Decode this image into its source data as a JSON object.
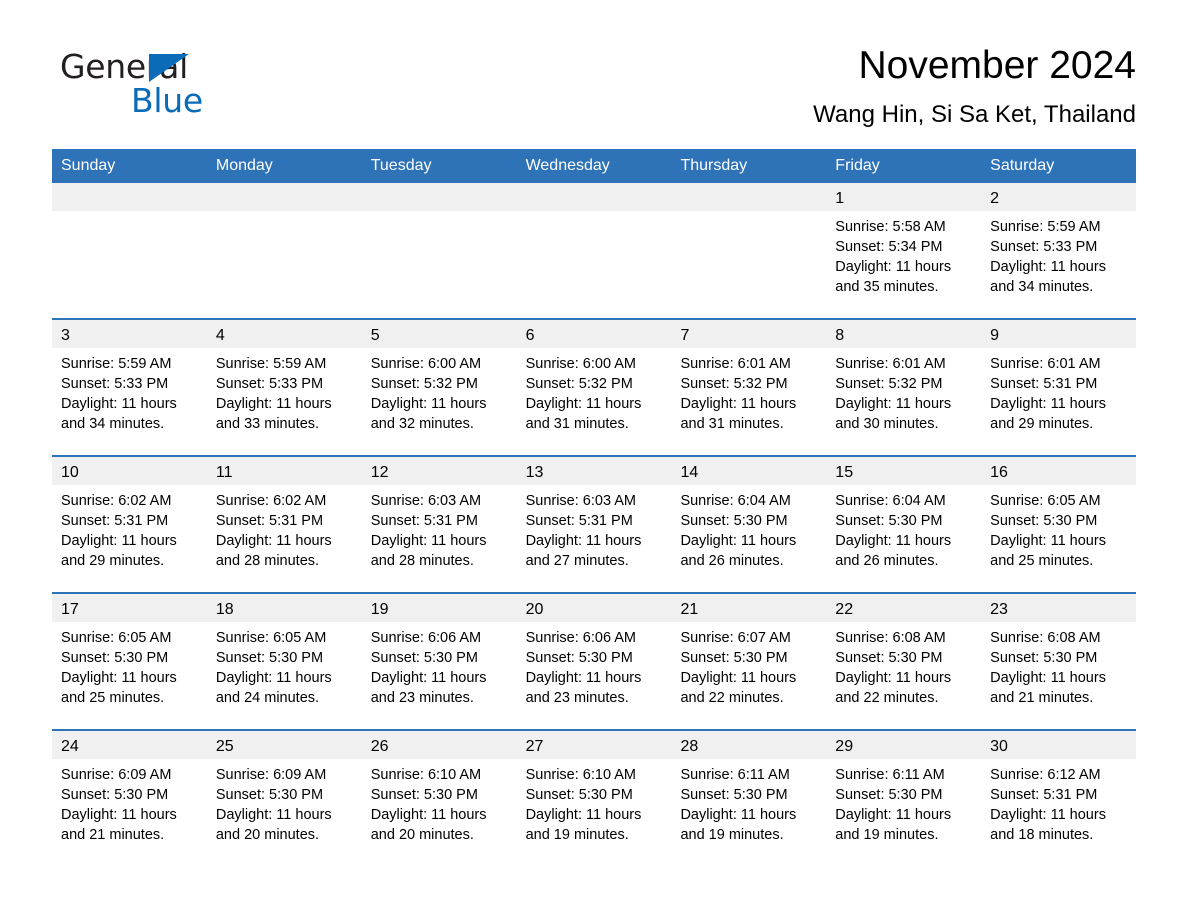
{
  "logo": {
    "word_dark": "General",
    "word_blue": "Blue",
    "triangle_color": "#0a6cb8"
  },
  "header": {
    "title": "November 2024",
    "subtitle": "Wang Hin, Si Sa Ket, Thailand"
  },
  "colors": {
    "header_blue": "#2e72b8",
    "date_strip": "#f0f0f0",
    "text": "#000000",
    "logo_blue": "#0a6cb8"
  },
  "weekdays": [
    "Sunday",
    "Monday",
    "Tuesday",
    "Wednesday",
    "Thursday",
    "Friday",
    "Saturday"
  ],
  "weeks": [
    [
      {
        "day": "",
        "sunrise": "",
        "sunset": "",
        "daylight": ""
      },
      {
        "day": "",
        "sunrise": "",
        "sunset": "",
        "daylight": ""
      },
      {
        "day": "",
        "sunrise": "",
        "sunset": "",
        "daylight": ""
      },
      {
        "day": "",
        "sunrise": "",
        "sunset": "",
        "daylight": ""
      },
      {
        "day": "",
        "sunrise": "",
        "sunset": "",
        "daylight": ""
      },
      {
        "day": "1",
        "sunrise": "Sunrise: 5:58 AM",
        "sunset": "Sunset: 5:34 PM",
        "daylight": "Daylight: 11 hours and 35 minutes."
      },
      {
        "day": "2",
        "sunrise": "Sunrise: 5:59 AM",
        "sunset": "Sunset: 5:33 PM",
        "daylight": "Daylight: 11 hours and 34 minutes."
      }
    ],
    [
      {
        "day": "3",
        "sunrise": "Sunrise: 5:59 AM",
        "sunset": "Sunset: 5:33 PM",
        "daylight": "Daylight: 11 hours and 34 minutes."
      },
      {
        "day": "4",
        "sunrise": "Sunrise: 5:59 AM",
        "sunset": "Sunset: 5:33 PM",
        "daylight": "Daylight: 11 hours and 33 minutes."
      },
      {
        "day": "5",
        "sunrise": "Sunrise: 6:00 AM",
        "sunset": "Sunset: 5:32 PM",
        "daylight": "Daylight: 11 hours and 32 minutes."
      },
      {
        "day": "6",
        "sunrise": "Sunrise: 6:00 AM",
        "sunset": "Sunset: 5:32 PM",
        "daylight": "Daylight: 11 hours and 31 minutes."
      },
      {
        "day": "7",
        "sunrise": "Sunrise: 6:01 AM",
        "sunset": "Sunset: 5:32 PM",
        "daylight": "Daylight: 11 hours and 31 minutes."
      },
      {
        "day": "8",
        "sunrise": "Sunrise: 6:01 AM",
        "sunset": "Sunset: 5:32 PM",
        "daylight": "Daylight: 11 hours and 30 minutes."
      },
      {
        "day": "9",
        "sunrise": "Sunrise: 6:01 AM",
        "sunset": "Sunset: 5:31 PM",
        "daylight": "Daylight: 11 hours and 29 minutes."
      }
    ],
    [
      {
        "day": "10",
        "sunrise": "Sunrise: 6:02 AM",
        "sunset": "Sunset: 5:31 PM",
        "daylight": "Daylight: 11 hours and 29 minutes."
      },
      {
        "day": "11",
        "sunrise": "Sunrise: 6:02 AM",
        "sunset": "Sunset: 5:31 PM",
        "daylight": "Daylight: 11 hours and 28 minutes."
      },
      {
        "day": "12",
        "sunrise": "Sunrise: 6:03 AM",
        "sunset": "Sunset: 5:31 PM",
        "daylight": "Daylight: 11 hours and 28 minutes."
      },
      {
        "day": "13",
        "sunrise": "Sunrise: 6:03 AM",
        "sunset": "Sunset: 5:31 PM",
        "daylight": "Daylight: 11 hours and 27 minutes."
      },
      {
        "day": "14",
        "sunrise": "Sunrise: 6:04 AM",
        "sunset": "Sunset: 5:30 PM",
        "daylight": "Daylight: 11 hours and 26 minutes."
      },
      {
        "day": "15",
        "sunrise": "Sunrise: 6:04 AM",
        "sunset": "Sunset: 5:30 PM",
        "daylight": "Daylight: 11 hours and 26 minutes."
      },
      {
        "day": "16",
        "sunrise": "Sunrise: 6:05 AM",
        "sunset": "Sunset: 5:30 PM",
        "daylight": "Daylight: 11 hours and 25 minutes."
      }
    ],
    [
      {
        "day": "17",
        "sunrise": "Sunrise: 6:05 AM",
        "sunset": "Sunset: 5:30 PM",
        "daylight": "Daylight: 11 hours and 25 minutes."
      },
      {
        "day": "18",
        "sunrise": "Sunrise: 6:05 AM",
        "sunset": "Sunset: 5:30 PM",
        "daylight": "Daylight: 11 hours and 24 minutes."
      },
      {
        "day": "19",
        "sunrise": "Sunrise: 6:06 AM",
        "sunset": "Sunset: 5:30 PM",
        "daylight": "Daylight: 11 hours and 23 minutes."
      },
      {
        "day": "20",
        "sunrise": "Sunrise: 6:06 AM",
        "sunset": "Sunset: 5:30 PM",
        "daylight": "Daylight: 11 hours and 23 minutes."
      },
      {
        "day": "21",
        "sunrise": "Sunrise: 6:07 AM",
        "sunset": "Sunset: 5:30 PM",
        "daylight": "Daylight: 11 hours and 22 minutes."
      },
      {
        "day": "22",
        "sunrise": "Sunrise: 6:08 AM",
        "sunset": "Sunset: 5:30 PM",
        "daylight": "Daylight: 11 hours and 22 minutes."
      },
      {
        "day": "23",
        "sunrise": "Sunrise: 6:08 AM",
        "sunset": "Sunset: 5:30 PM",
        "daylight": "Daylight: 11 hours and 21 minutes."
      }
    ],
    [
      {
        "day": "24",
        "sunrise": "Sunrise: 6:09 AM",
        "sunset": "Sunset: 5:30 PM",
        "daylight": "Daylight: 11 hours and 21 minutes."
      },
      {
        "day": "25",
        "sunrise": "Sunrise: 6:09 AM",
        "sunset": "Sunset: 5:30 PM",
        "daylight": "Daylight: 11 hours and 20 minutes."
      },
      {
        "day": "26",
        "sunrise": "Sunrise: 6:10 AM",
        "sunset": "Sunset: 5:30 PM",
        "daylight": "Daylight: 11 hours and 20 minutes."
      },
      {
        "day": "27",
        "sunrise": "Sunrise: 6:10 AM",
        "sunset": "Sunset: 5:30 PM",
        "daylight": "Daylight: 11 hours and 19 minutes."
      },
      {
        "day": "28",
        "sunrise": "Sunrise: 6:11 AM",
        "sunset": "Sunset: 5:30 PM",
        "daylight": "Daylight: 11 hours and 19 minutes."
      },
      {
        "day": "29",
        "sunrise": "Sunrise: 6:11 AM",
        "sunset": "Sunset: 5:30 PM",
        "daylight": "Daylight: 11 hours and 19 minutes."
      },
      {
        "day": "30",
        "sunrise": "Sunrise: 6:12 AM",
        "sunset": "Sunset: 5:31 PM",
        "daylight": "Daylight: 11 hours and 18 minutes."
      }
    ]
  ]
}
